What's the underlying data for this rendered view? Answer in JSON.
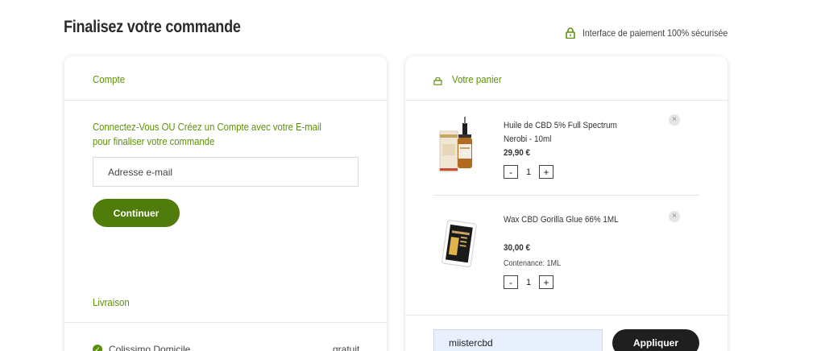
{
  "header": {
    "title": "Finalisez votre commande",
    "secure_label": "Interface de paiement 100% sécurisée",
    "secure_icon": "lock-icon"
  },
  "account": {
    "heading": "Compte",
    "prompt": "Connectez-Vous OU Créez un Compte avec votre E-mail pour finaliser votre commande",
    "email_placeholder": "Adresse e-mail",
    "continue_label": "Continuer"
  },
  "shipping": {
    "heading": "Livraison",
    "option_label": "Colissimo Domicile",
    "option_price": "gratuit"
  },
  "cart": {
    "heading": "Votre panier",
    "items": [
      {
        "name": "Huile de CBD 5% Full Spectrum Nerobi - 10ml",
        "price": "29,90 €",
        "variant": "",
        "quantity": "1",
        "minus": "-",
        "plus": "+",
        "remove": "×"
      },
      {
        "name": "Wax CBD Gorilla Glue 66% 1ML",
        "price": "30,00 €",
        "variant": "Contenance: 1ML",
        "quantity": "1",
        "minus": "-",
        "plus": "+",
        "remove": "×"
      }
    ],
    "coupon_value": "miistercbd",
    "apply_label": "Appliquer"
  },
  "colors": {
    "accent": "#5e8f0b",
    "button_green": "#4f7c0a",
    "button_dark": "#1f1f1f"
  }
}
